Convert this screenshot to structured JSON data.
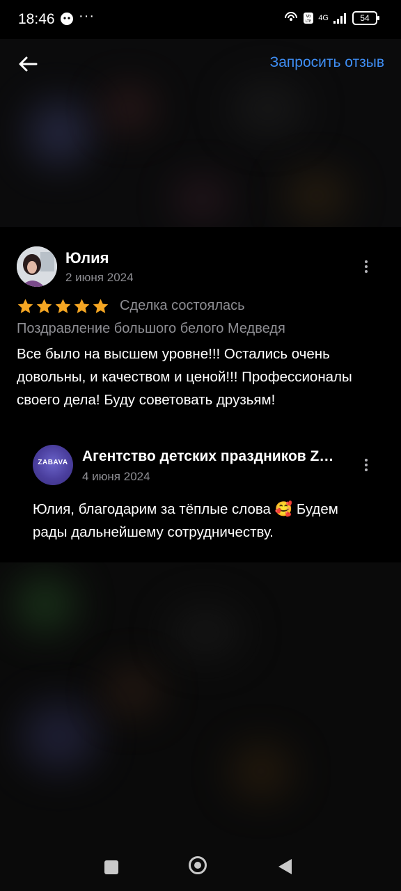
{
  "status_bar": {
    "time": "18:46",
    "more": "···",
    "network": "4G",
    "battery": "54"
  },
  "header": {
    "request_review_label": "Запросить отзыв"
  },
  "review": {
    "author": "Юлия",
    "date": "2 июня 2024",
    "rating": 5,
    "deal_status": "Сделка состоялась",
    "service": "Поздравление большого белого Медведя",
    "text": "Все было на высшем уровне!!! Остались очень довольны, и качеством и ценой!!! Профессионалы своего дела! Буду советовать друзьям!"
  },
  "reply": {
    "author": "Агентство детских праздников ZABAVA",
    "avatar_label": "ZABAVA",
    "date": "4 июня 2024",
    "text": "Юлия, благодарим за тёплые слова 🥰 Будем рады дальнейшему сотрудничеству."
  },
  "colors": {
    "accent_link": "#3f8ef4",
    "star": "#f5a623",
    "muted_text": "#8e8e93"
  }
}
